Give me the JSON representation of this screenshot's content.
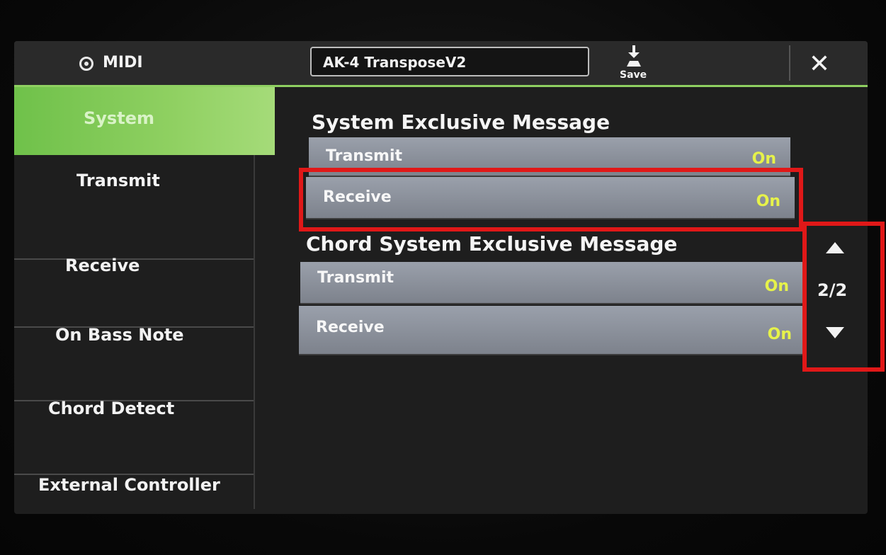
{
  "window": {
    "title": "MIDI",
    "file_name": "AK-4 TransposeV2",
    "save_label": "Save",
    "close_symbol": "✕"
  },
  "sidebar": {
    "items": [
      {
        "label": "System",
        "active": true
      },
      {
        "label": "Transmit",
        "active": false
      },
      {
        "label": "Receive",
        "active": false
      },
      {
        "label": "On Bass Note",
        "active": false
      },
      {
        "label": "Chord Detect",
        "active": false
      },
      {
        "label": "External Controller",
        "active": false
      }
    ]
  },
  "main": {
    "sections": [
      {
        "title": "System Exclusive Message",
        "rows": [
          {
            "label": "Transmit",
            "value": "On"
          },
          {
            "label": "Receive",
            "value": "On"
          }
        ]
      },
      {
        "title": "Chord System Exclusive Message",
        "rows": [
          {
            "label": "Transmit",
            "value": "On"
          },
          {
            "label": "Receive",
            "value": "On"
          }
        ]
      }
    ]
  },
  "pager": {
    "current": "2/2",
    "up_icon": "triangle-up-icon",
    "down_icon": "triangle-down-icon"
  },
  "colors": {
    "accent_green": "#8fd061",
    "value_yellow": "#e6f24a",
    "annotation_red": "#e01818",
    "row_gray": "#8a909a"
  }
}
